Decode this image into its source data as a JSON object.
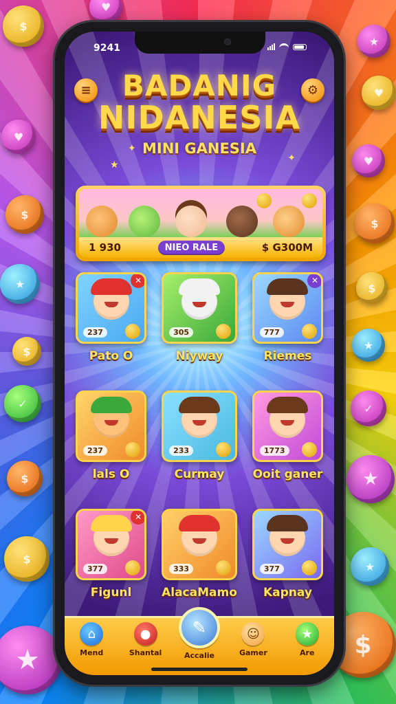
{
  "status_bar": {
    "time": "9241"
  },
  "header": {
    "title_line1": "BADANIG",
    "title_line2": "NIDANESIA",
    "subtitle": "MINI GANESIA"
  },
  "banner": {
    "left_stat": "1 930",
    "tag": "NIEO RALE",
    "right_stat": "$ G300M"
  },
  "games": [
    {
      "label": "Pato O",
      "stat": "237"
    },
    {
      "label": "Niyway",
      "stat": "305"
    },
    {
      "label": "Riemes",
      "stat": "777"
    },
    {
      "label": "lals O",
      "stat": "237"
    },
    {
      "label": "Curmay",
      "stat": "233"
    },
    {
      "label": "Ooit ganer",
      "stat": "1773"
    },
    {
      "label": "Figunl",
      "stat": "377"
    },
    {
      "label": "AlacaMamo",
      "stat": "333"
    },
    {
      "label": "Kapnay",
      "stat": "377"
    }
  ],
  "nav": [
    {
      "label": "Mend",
      "icon": "home-icon"
    },
    {
      "label": "Shantal",
      "icon": "apple-icon"
    },
    {
      "label": "Accalie",
      "icon": "feather-icon"
    },
    {
      "label": "Gamer",
      "icon": "face-icon"
    },
    {
      "label": "Are",
      "icon": "star-icon"
    }
  ],
  "colors": {
    "accent": "#ffd34a",
    "title": "#ffd94a",
    "nav_bg": "#f29a00",
    "tag_bg": "#7b3fd0"
  }
}
